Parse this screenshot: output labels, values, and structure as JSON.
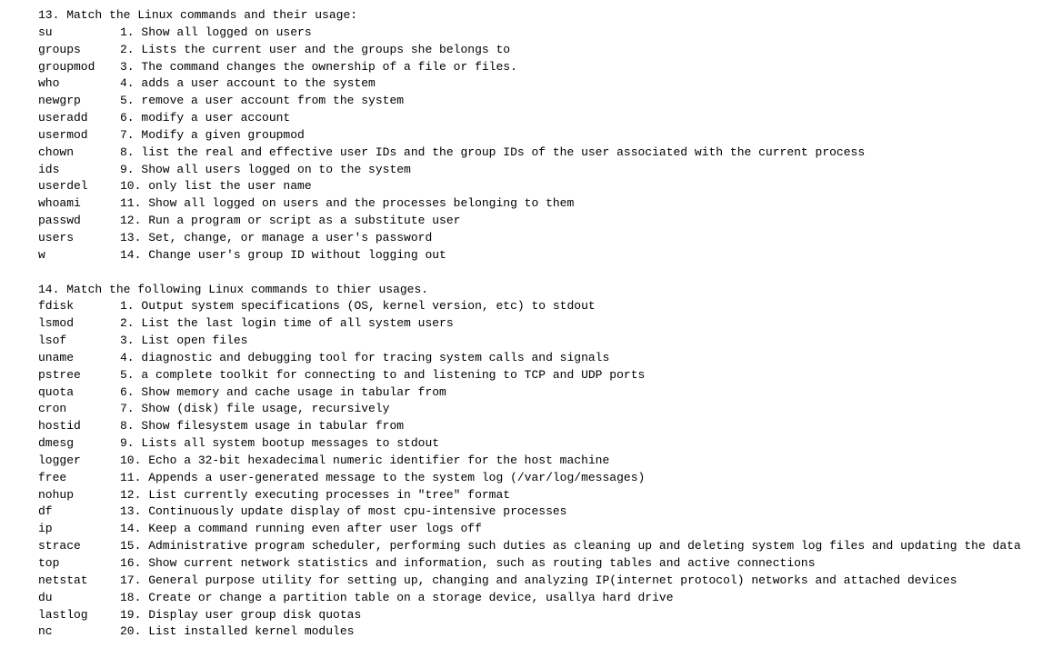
{
  "q13": {
    "title": "13. Match the Linux commands and their usage:",
    "rows": [
      {
        "cmd": "su",
        "desc": "1. Show all logged on users"
      },
      {
        "cmd": "groups",
        "desc": "2. Lists the current user and the groups she belongs to"
      },
      {
        "cmd": "groupmod",
        "desc": "3. The command changes the ownership of a file or files."
      },
      {
        "cmd": "who",
        "desc": "4. adds a user account to the system"
      },
      {
        "cmd": "newgrp",
        "desc": "5. remove a user account from the system"
      },
      {
        "cmd": "useradd",
        "desc": "6. modify a user account"
      },
      {
        "cmd": "usermod",
        "desc": "7. Modify a given groupmod"
      },
      {
        "cmd": "chown",
        "desc": "8. list the real and effective user IDs and the group IDs of the user associated with the current process"
      },
      {
        "cmd": "ids",
        "desc": "9. Show all users logged on to the system"
      },
      {
        "cmd": "userdel",
        "desc": "10. only list the user name"
      },
      {
        "cmd": "whoami",
        "desc": "11. Show all logged on users and the processes belonging to them"
      },
      {
        "cmd": "passwd",
        "desc": "12. Run a program or script as a substitute user"
      },
      {
        "cmd": "users",
        "desc": "13. Set, change, or manage a user's password"
      },
      {
        "cmd": "w",
        "desc": "14. Change user's group ID without logging out"
      }
    ]
  },
  "q14": {
    "title": "14. Match the following Linux commands to thier usages.",
    "rows": [
      {
        "cmd": "fdisk",
        "desc": "1. Output system specifications (OS, kernel version, etc) to stdout"
      },
      {
        "cmd": "lsmod",
        "desc": "2. List the last login time of all system users"
      },
      {
        "cmd": "lsof",
        "desc": "3. List open files"
      },
      {
        "cmd": "uname",
        "desc": "4. diagnostic and debugging tool for tracing system calls and signals"
      },
      {
        "cmd": "pstree",
        "desc": "5. a complete toolkit for connecting to and listening to TCP and UDP ports"
      },
      {
        "cmd": "quota",
        "desc": "6. Show memory and cache usage in tabular from"
      },
      {
        "cmd": "cron",
        "desc": "7. Show (disk) file usage, recursively"
      },
      {
        "cmd": "hostid",
        "desc": "8. Show filesystem usage in tabular from"
      },
      {
        "cmd": "dmesg",
        "desc": "9. Lists all system bootup messages to stdout"
      },
      {
        "cmd": "logger",
        "desc": "10. Echo a 32-bit hexadecimal numeric identifier for the host machine"
      },
      {
        "cmd": "free",
        "desc": "11. Appends a user-generated message to the system log (/var/log/messages)"
      },
      {
        "cmd": "nohup",
        "desc": "12. List currently executing processes in \"tree\" format"
      },
      {
        "cmd": "df",
        "desc": "13. Continuously update display of most cpu-intensive processes"
      },
      {
        "cmd": "ip",
        "desc": "14. Keep a command running even after user logs off"
      },
      {
        "cmd": "strace",
        "desc": "15. Administrative program scheduler, performing such duties as cleaning up and deleting system log files and updating the data"
      },
      {
        "cmd": "top",
        "desc": "16. Show current network statistics and information, such as routing tables and active connections"
      },
      {
        "cmd": "netstat",
        "desc": "17. General purpose utility for setting up, changing and analyzing IP(internet protocol) networks and attached devices"
      },
      {
        "cmd": "du",
        "desc": "18. Create or change a partition table on a storage device, usallya hard drive"
      },
      {
        "cmd": "lastlog",
        "desc": "19. Display user group disk quotas"
      },
      {
        "cmd": "nc",
        "desc": "20. List installed kernel modules"
      }
    ]
  }
}
